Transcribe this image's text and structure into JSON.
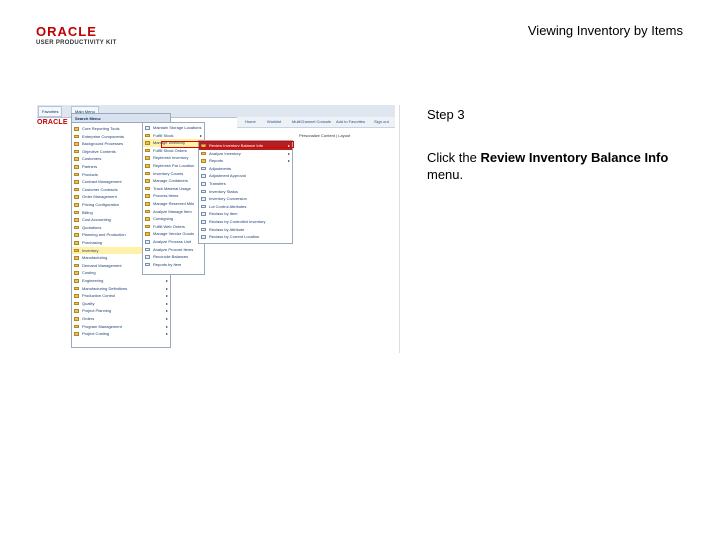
{
  "header": {
    "logo_text": "ORACLE",
    "logo_sub": "USER PRODUCTIVITY KIT",
    "doc_title": "Viewing Inventory by Items"
  },
  "screenshot": {
    "tabs": [
      "Favorites",
      "Main Menu"
    ],
    "app_logo": "ORACLE",
    "search_menu_label": "Search Menu:",
    "nav_links": [
      "Home",
      "Worklist",
      "MultiChannel Console",
      "Add to Favorites",
      "Sign out"
    ],
    "personalize_text": "Personalize Content | Layout",
    "menu1_items": [
      {
        "label": "Core Reporting Tools",
        "arrow": true
      },
      {
        "label": "Enterprise Components",
        "arrow": true
      },
      {
        "label": "Background Processes",
        "arrow": true
      },
      {
        "label": "Objective Contents",
        "arrow": true
      },
      {
        "label": "Customers",
        "arrow": true
      },
      {
        "label": "Partners",
        "arrow": true
      },
      {
        "label": "Products",
        "arrow": true
      },
      {
        "label": "Contract Management",
        "arrow": true
      },
      {
        "label": "Customer Contracts",
        "arrow": true
      },
      {
        "label": "Order Management",
        "arrow": true
      },
      {
        "label": "Pricing Configuration",
        "arrow": true
      },
      {
        "label": "Billing",
        "arrow": true
      },
      {
        "label": "Cost Accounting",
        "arrow": true
      },
      {
        "label": "Quotations",
        "arrow": true
      },
      {
        "label": "Planning and Production",
        "arrow": true
      },
      {
        "label": "Purchasing",
        "arrow": true
      },
      {
        "label": "Inventory",
        "arrow": true,
        "state": "highlight"
      },
      {
        "label": "Manufacturing",
        "arrow": true
      },
      {
        "label": "Demand Management",
        "arrow": true
      },
      {
        "label": "Costing",
        "arrow": true
      },
      {
        "label": "Engineering",
        "arrow": true
      },
      {
        "label": "Manufacturing Definitions",
        "arrow": true
      },
      {
        "label": "Production Control",
        "arrow": true
      },
      {
        "label": "Quality",
        "arrow": true
      },
      {
        "label": "Project Planning",
        "arrow": true
      },
      {
        "label": "Orders",
        "arrow": true
      },
      {
        "label": "Program Management",
        "arrow": true
      },
      {
        "label": "Project Costing",
        "arrow": true
      }
    ],
    "menu2_items": [
      {
        "label": "Maintain Storage Locations",
        "icon": "doc"
      },
      {
        "label": "Fulfill Stock",
        "arrow": true
      },
      {
        "label": "Manage Inventory",
        "arrow": true,
        "state": "highlight"
      },
      {
        "label": "Fulfill Stock Orders",
        "arrow": true
      },
      {
        "label": "Replenish Inventory",
        "arrow": true
      },
      {
        "label": "Replenish Par Location",
        "arrow": true
      },
      {
        "label": "Inventory Counts",
        "arrow": true
      },
      {
        "label": "Manage Containers",
        "arrow": true
      },
      {
        "label": "Track Material Usage",
        "arrow": true
      },
      {
        "label": "Process Items",
        "arrow": true
      },
      {
        "label": "Manage Reserved Mtls",
        "arrow": true
      },
      {
        "label": "Analyze Manage Item",
        "arrow": true
      },
      {
        "label": "Consigning",
        "arrow": true
      },
      {
        "label": "Fulfill Web Orders",
        "arrow": true
      },
      {
        "label": "Manage Vendor Goods",
        "arrow": true
      },
      {
        "label": "Analyze Process Unit",
        "icon": "doc"
      },
      {
        "label": "Analyze Procure Items",
        "icon": "doc"
      },
      {
        "label": "Reconcile Balances",
        "icon": "doc"
      },
      {
        "label": "Reports by Item",
        "icon": "doc"
      }
    ],
    "menu3_items": [
      {
        "label": "Review Inventory Balance Info",
        "arrow": true,
        "state": "selected"
      },
      {
        "label": "Analyze Inventory",
        "arrow": true
      },
      {
        "label": "Reports",
        "arrow": true
      },
      {
        "label": "Adjustments",
        "icon": "doc"
      },
      {
        "label": "Adjustment Approval",
        "icon": "doc"
      },
      {
        "label": "Transfers",
        "icon": "doc"
      },
      {
        "label": "Inventory Status",
        "icon": "doc"
      },
      {
        "label": "Inventory Conversion",
        "icon": "doc"
      },
      {
        "label": "Lot Control Attributes",
        "icon": "doc"
      },
      {
        "label": "Reclass by Item",
        "icon": "doc"
      },
      {
        "label": "Reclass by Controlled Inventory",
        "icon": "doc"
      },
      {
        "label": "Reclass by Attribute",
        "icon": "doc"
      },
      {
        "label": "Reclass by Current Location",
        "icon": "doc"
      }
    ]
  },
  "step": {
    "title": "Step 3",
    "instruction_prefix": "Click the ",
    "instruction_target": "Review Inventory Balance Info",
    "instruction_suffix": " menu."
  }
}
